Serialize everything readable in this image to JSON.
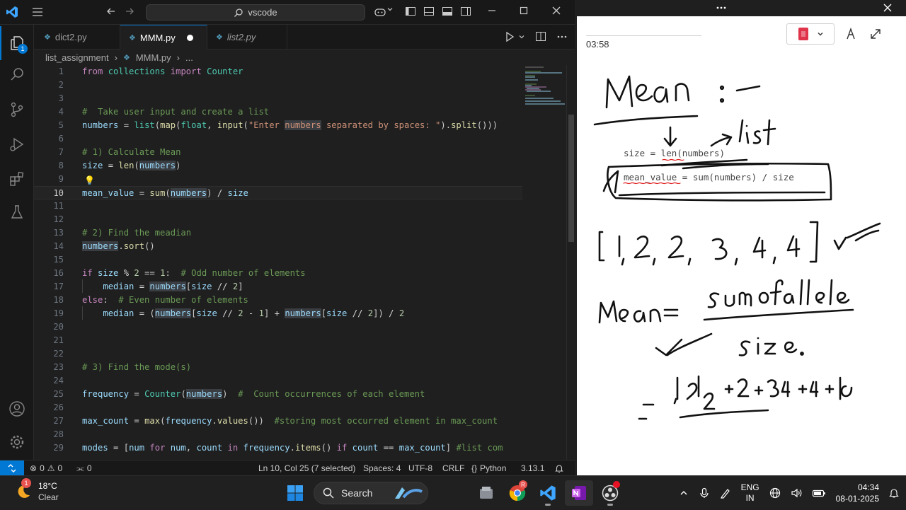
{
  "vscode": {
    "search_text": "vscode",
    "tabs": [
      {
        "label": "dict2.py",
        "active": false,
        "modified": false
      },
      {
        "label": "MMM.py",
        "active": true,
        "modified": true
      },
      {
        "label": "list2.py",
        "active": false,
        "modified": false
      }
    ],
    "explorer_badge": "1",
    "breadcrumb": {
      "folder": "list_assignment",
      "file": "MMM.py",
      "more": "..."
    },
    "code_lines": [
      {
        "n": "1"
      },
      {
        "n": "2"
      },
      {
        "n": "3"
      },
      {
        "n": "4"
      },
      {
        "n": "5"
      },
      {
        "n": "6"
      },
      {
        "n": "7"
      },
      {
        "n": "8"
      },
      {
        "n": "9"
      },
      {
        "n": "10"
      },
      {
        "n": "11"
      },
      {
        "n": "12"
      },
      {
        "n": "13"
      },
      {
        "n": "14"
      },
      {
        "n": "15"
      },
      {
        "n": "16"
      },
      {
        "n": "17"
      },
      {
        "n": "18"
      },
      {
        "n": "19"
      },
      {
        "n": "20"
      },
      {
        "n": "21"
      },
      {
        "n": "22"
      },
      {
        "n": "23"
      },
      {
        "n": "24"
      },
      {
        "n": "25"
      },
      {
        "n": "26"
      },
      {
        "n": "27"
      },
      {
        "n": "28"
      },
      {
        "n": "29"
      }
    ],
    "current_line": "10",
    "status": {
      "errors": "0",
      "warnings": "0",
      "ports": "0",
      "position": "Ln 10, Col 25 (7 selected)",
      "spaces": "Spaces: 4",
      "encoding": "UTF-8",
      "eol": "CRLF",
      "language_icon": "{}",
      "language": "Python",
      "python_version": "3.13.1"
    }
  },
  "board": {
    "timer": "03:58",
    "pasted_size_line": "size = len(numbers)",
    "pasted_mean_line": "mean_value = sum(numbers) / size"
  },
  "taskbar": {
    "weather_temp": "18°C",
    "weather_desc": "Clear",
    "weather_badge": "1",
    "search_label": "Search",
    "language_top": "ENG",
    "language_bottom": "IN",
    "time": "04:34",
    "date": "08-01-2025"
  },
  "colors": {
    "accent": "#0078d4",
    "editor_bg": "#1f1f1f",
    "chrome_bg": "#181818",
    "taskbar_bg": "#202020"
  }
}
